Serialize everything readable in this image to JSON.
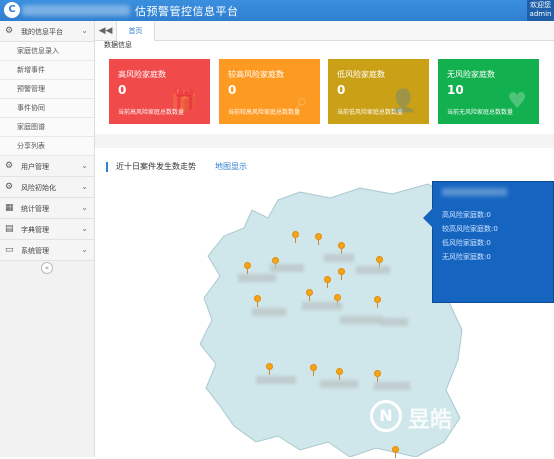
{
  "header": {
    "logo_char": "C",
    "title": "估预警管控信息平台",
    "user_greeting": "欢迎您",
    "user_name": "admin"
  },
  "sidebar": {
    "groups": [
      {
        "icon": "⚙",
        "label": "我的信息平台",
        "chevron": "⌄",
        "items": [
          "家庭信息录入",
          "新增事件",
          "预警管理",
          "事件协同",
          "家庭图谱",
          "分享列表"
        ]
      },
      {
        "icon": "⚙",
        "label": "用户管理",
        "chevron": "⌄"
      },
      {
        "icon": "⚙",
        "label": "风险初始化",
        "chevron": "⌄"
      },
      {
        "icon": "▦",
        "label": "统计管理",
        "chevron": "⌄"
      },
      {
        "icon": "▤",
        "label": "字典管理",
        "chevron": "⌄"
      },
      {
        "icon": "▭",
        "label": "系统管理",
        "chevron": "⌄"
      }
    ],
    "collapse_glyph": "«"
  },
  "tabs": {
    "back_glyph": "◀◀",
    "home": "首页"
  },
  "section": {
    "title": "数据信息"
  },
  "cards": [
    {
      "label": "高风险家庭数",
      "value": "0",
      "desc": "当前高风险家庭总数数量",
      "color": "#f04a4a",
      "icon": "gift-icon"
    },
    {
      "label": "较高风险家庭数",
      "value": "0",
      "desc": "当前较高风险家庭总数数量",
      "color": "#fd9a21",
      "icon": "search-icon"
    },
    {
      "label": "低风险家庭数",
      "value": "0",
      "desc": "当前低风险家庭总数数量",
      "color": "#caa016",
      "icon": "user-icon"
    },
    {
      "label": "无风险家庭数",
      "value": "10",
      "desc": "当前无风险家庭总数数量",
      "color": "#12b04e",
      "icon": "heart-icon"
    }
  ],
  "chart": {
    "title": "近十日案件发生数走势",
    "map_link": "地图显示"
  },
  "info_panel": {
    "lines": [
      "高风险家庭数:0",
      "较高风险家庭数:0",
      "低风险家庭数:0",
      "无风险家庭数:0"
    ]
  },
  "watermark": {
    "text": "昱皓"
  }
}
